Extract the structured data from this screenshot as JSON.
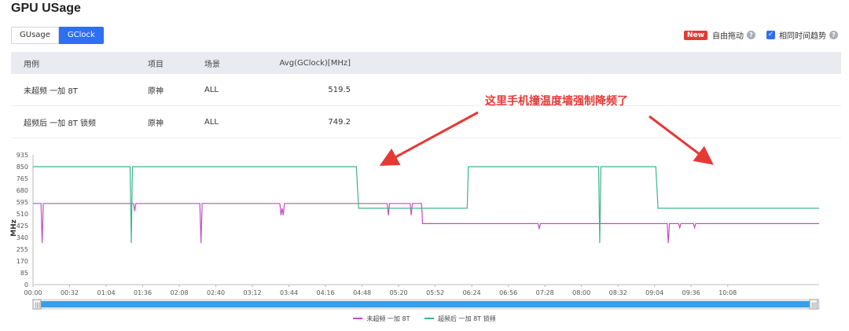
{
  "page": {
    "title": "GPU USage"
  },
  "tabs": [
    {
      "label": "GUsage",
      "active": false
    },
    {
      "label": "GClock",
      "active": true
    }
  ],
  "options": {
    "new_badge": "New",
    "free_drag_label": "自由拖动",
    "same_time_trend_label": "相同时间趋势",
    "same_time_trend_checked": true
  },
  "table": {
    "headers": [
      "用例",
      "项目",
      "场景",
      "Avg(GClock)[MHz]"
    ],
    "rows": [
      [
        "未超频 一加 8T",
        "原神",
        "ALL",
        "519.5"
      ],
      [
        "超频后 一加 8T 锁频",
        "原神",
        "ALL",
        "749.2"
      ]
    ]
  },
  "annotation": "这里手机撞温度墙强制降频了",
  "colors": {
    "accent": "#2f6ef6",
    "series_a": "#c44ec4",
    "series_b": "#3fb58a",
    "annotation": "#e53935",
    "scrollbar": "#3a9ee8"
  },
  "chart_data": {
    "type": "line",
    "ylabel": "MHz",
    "ylim": [
      0,
      935
    ],
    "yticks": [
      0,
      85,
      170,
      255,
      340,
      425,
      510,
      595,
      680,
      765,
      850,
      935
    ],
    "xlim_seconds": [
      0,
      688
    ],
    "xticks": [
      "00:00",
      "00:32",
      "01:04",
      "01:36",
      "02:08",
      "02:40",
      "03:12",
      "03:44",
      "04:16",
      "04:48",
      "05:20",
      "05:52",
      "06:24",
      "06:56",
      "07:28",
      "08:00",
      "08:32",
      "09:04",
      "09:36",
      "10:08"
    ],
    "grid": false,
    "legend_position": "bottom-center",
    "series": [
      {
        "name": "未超频 一加 8T",
        "points": [
          [
            0,
            585
          ],
          [
            7,
            585
          ],
          [
            8,
            300
          ],
          [
            9,
            585
          ],
          [
            88,
            585
          ],
          [
            89,
            530
          ],
          [
            90,
            585
          ],
          [
            146,
            585
          ],
          [
            147,
            300
          ],
          [
            148,
            585
          ],
          [
            216,
            585
          ],
          [
            217,
            500
          ],
          [
            218,
            550
          ],
          [
            219,
            500
          ],
          [
            220,
            585
          ],
          [
            310,
            585
          ],
          [
            311,
            500
          ],
          [
            312,
            585
          ],
          [
            330,
            585
          ],
          [
            331,
            500
          ],
          [
            332,
            585
          ],
          [
            340,
            585
          ],
          [
            341,
            440
          ],
          [
            342,
            440
          ],
          [
            343,
            440
          ],
          [
            345,
            440
          ],
          [
            346,
            440
          ],
          [
            347,
            440
          ],
          [
            442,
            440
          ],
          [
            443,
            400
          ],
          [
            444,
            440
          ],
          [
            555,
            440
          ],
          [
            556,
            300
          ],
          [
            557,
            440
          ],
          [
            565,
            440
          ],
          [
            566,
            410
          ],
          [
            567,
            440
          ],
          [
            578,
            440
          ],
          [
            579,
            410
          ],
          [
            580,
            440
          ],
          [
            688,
            440
          ]
        ]
      },
      {
        "name": "超频后 一加 8T 锁频",
        "points": [
          [
            0,
            850
          ],
          [
            85,
            850
          ],
          [
            86,
            300
          ],
          [
            87,
            850
          ],
          [
            283,
            850
          ],
          [
            285,
            550
          ],
          [
            380,
            550
          ],
          [
            381,
            850
          ],
          [
            495,
            850
          ],
          [
            496,
            300
          ],
          [
            497,
            850
          ],
          [
            545,
            850
          ],
          [
            547,
            550
          ],
          [
            688,
            550
          ]
        ]
      }
    ]
  }
}
